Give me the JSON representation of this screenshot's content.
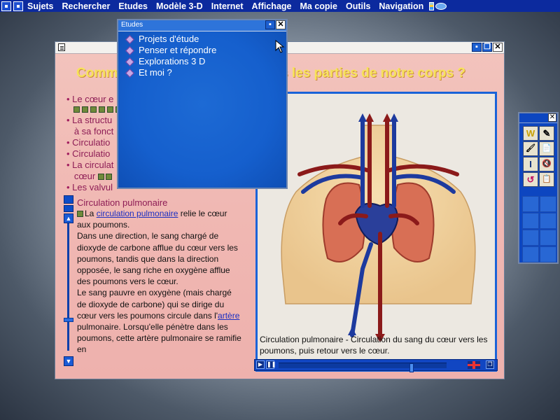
{
  "menubar": {
    "items": [
      "Sujets",
      "Rechercher",
      "Etudes",
      "Modèle 3-D",
      "Internet",
      "Affichage",
      "Ma copie",
      "Outils",
      "Navigation"
    ]
  },
  "main_window": {
    "title_left": "Comm",
    "title_right": "s les parties de notre corps ?",
    "toc": [
      "Le cœur e",
      "La structu",
      "à sa fonct",
      "Circulatio",
      "Circulatio",
      "La circulat",
      "cœur",
      "Les valvul"
    ],
    "article": {
      "heading": "Circulation pulmonaire",
      "p1_pre": "La ",
      "p1_link": "circulation pulmonaire",
      "p1_post": " relie le cœur aux poumons.",
      "p2": "Dans une direction, le sang chargé de dioxyde de carbone afflue du cœur vers les poumons, tandis que dans la direction opposée, le sang riche en oxygène afflue des poumons vers le cœur.",
      "p3_pre": "Le sang pauvre en oxygène (mais chargé de dioxyde de carbone) qui se dirige du cœur vers les poumons circule dans l'",
      "p3_link": "artère",
      "p3_post": " pulmonaire. Lorsqu'elle pénètre dans les poumons, cette artère pulmonaire se ramifie en"
    },
    "caption": "Circulation pulmonaire - Circulation du sang du cœur vers les poumons, puis retour vers le cœur.",
    "media_progress": 0.8
  },
  "etudes_popup": {
    "title": "Etudes",
    "items": [
      "Projets d'étude",
      "Penser et répondre",
      "Explorations 3 D",
      "Et moi ?"
    ]
  },
  "tool_palette": {
    "tools": [
      "W",
      "✎",
      "🖌",
      "📄",
      "I",
      "🔇",
      "↺",
      "📋"
    ]
  },
  "colors": {
    "menubar": "#0c2a9e",
    "window_bg": "#f0b8b3",
    "title": "#f7e35a",
    "toc_text": "#8d1c55",
    "link": "#1b2ec2",
    "panel_border": "#1a63d8",
    "popup_bg": "#155fcd",
    "artery": "#8b1a1a",
    "vein": "#1d3a9e"
  }
}
